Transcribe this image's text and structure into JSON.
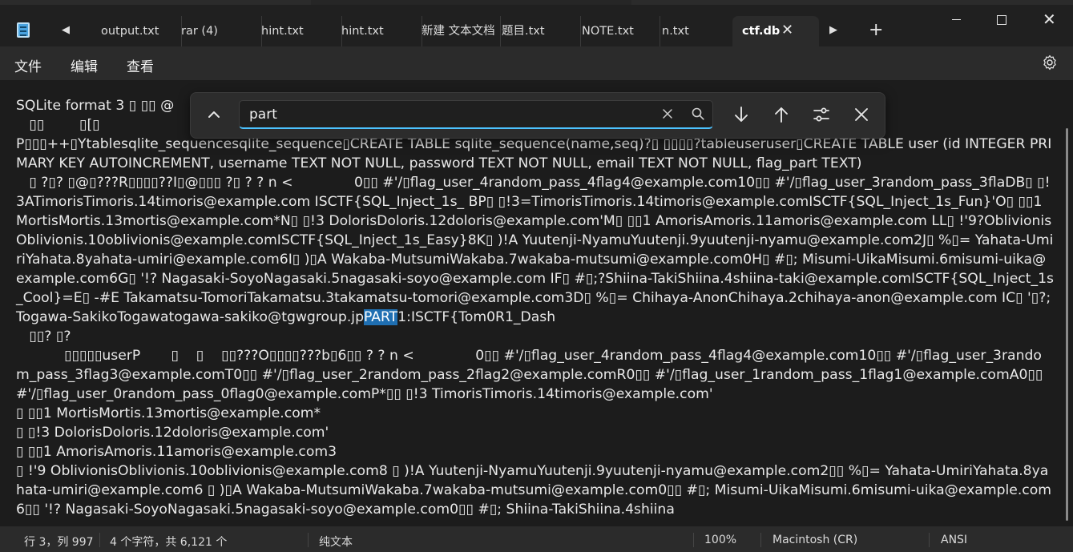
{
  "tabs": [
    {
      "label": "output.txt"
    },
    {
      "label": "rar (4)"
    },
    {
      "label": "hint.txt"
    },
    {
      "label": "hint.txt"
    },
    {
      "label": "新建 文本文档"
    },
    {
      "label": "题目.txt"
    },
    {
      "label": "NOTE.txt"
    },
    {
      "label": "n.txt"
    },
    {
      "label": "ctf.db"
    }
  ],
  "active_tab": "ctf.db",
  "menu": {
    "file": "文件",
    "edit": "编辑",
    "view": "查看"
  },
  "find": {
    "query": "part"
  },
  "content": {
    "before": "SQLite format 3 ▯ ▯▯ @\n   ▯▯        ▯[▯\nP▯▯▯++▯Ytablesqlite_sequencesqlite_sequence▯CREATE TABLE sqlite_sequence(name,seq)?▯ ▯▯▯▯?tableuseruser▯CREATE TABLE user (id INTEGER PRIMARY KEY AUTOINCREMENT, username TEXT NOT NULL, password TEXT NOT NULL, email TEXT NOT NULL, flag_part TEXT)\n   ▯ ?▯? ▯@▯???R▯▯▯▯??I▯@▯▯▯ ?▯ ? ? n <              0▯▯ #'/▯flag_user_4random_pass_4flag4@example.com10▯▯ #'/▯flag_user_3random_pass_3flaDB▯ ▯!3ATimorisTimoris.14timoris@example.com ISCTF{SQL_Inject_1s_ BP▯ ▯!3=TimorisTimoris.14timoris@example.comISCTF{SQL_Inject_1s_Fun}'O▯ ▯▯1 MortisMortis.13mortis@example.com*N▯ ▯!3 DolorisDoloris.12doloris@example.com'M▯ ▯▯1 AmorisAmoris.11amoris@example.com LL▯ !'9?OblivionisOblivionis.10oblivionis@example.comISCTF{SQL_Inject_1s_Easy}8K▯ )!A Yuutenji-NyamuYuutenji.9yuutenji-nyamu@example.com2J▯ %▯= Yahata-UmiriYahata.8yahata-umiri@example.com6I▯ )▯A Wakaba-MutsumiWakaba.7wakaba-mutsumi@example.com0H▯ #▯; Misumi-UikaMisumi.6misumi-uika@example.com6G▯ '!? Nagasaki-SoyoNagasaki.5nagasaki-soyo@example.com IF▯ #▯;?Shiina-TakiShiina.4shiina-taki@example.comISCTF{SQL_Inject_1s_Cool}=E▯ -#E Takamatsu-TomoriTakamatsu.3takamatsu-tomori@example.com3D▯ %▯= Chihaya-AnonChihaya.2chihaya-anon@example.com IC▯ '▯?;Togawa-SakikoTogawatogawa-sakiko@tgwgroup.jp",
    "match": "PART",
    "after": "1:ISCTF{Tom0R1_Dash\n   ▯▯? ▯?\n           ▯▯▯▯▯userP       ▯    ▯    ▯▯???O▯▯▯▯???b▯6▯▯ ? ? n <              0▯▯ #'/▯flag_user_4random_pass_4flag4@example.com10▯▯ #'/▯flag_user_3random_pass_3flag3@example.comT0▯▯ #'/▯flag_user_2random_pass_2flag2@example.comR0▯▯ #'/▯flag_user_1random_pass_1flag1@example.comA0▯▯ #'/▯flag_user_0random_pass_0flag0@example.comP*▯▯ ▯!3 TimorisTimoris.14timoris@example.com'\n▯ ▯▯1 MortisMortis.13mortis@example.com*\n▯ ▯!3 DolorisDoloris.12doloris@example.com'\n▯ ▯▯1 AmorisAmoris.11amoris@example.com3\n▯ !'9 OblivionisOblivionis.10oblivionis@example.com8 ▯ )!A Yuutenji-NyamuYuutenji.9yuutenji-nyamu@example.com2▯▯ %▯= Yahata-UmiriYahata.8yahata-umiri@example.com6 ▯ )▯A Wakaba-MutsumiWakaba.7wakaba-mutsumi@example.com0▯▯ #▯; Misumi-UikaMisumi.6misumi-uika@example.com6▯▯ '!? Nagasaki-SoyoNagasaki.5nagasaki-soyo@example.com0▯▯ #▯; Shiina-TakiShiina.4shiina"
  },
  "status": {
    "position": "行 3，列 997",
    "selection": "4 个字符，共 6,121 个",
    "format": "纯文本",
    "zoom": "100%",
    "line_ending": "Macintosh (CR)",
    "encoding": "ANSI"
  },
  "colors": {
    "accent": "#4cc2ff",
    "highlight": "#1f6fb2",
    "background": "#1c1c1c"
  }
}
